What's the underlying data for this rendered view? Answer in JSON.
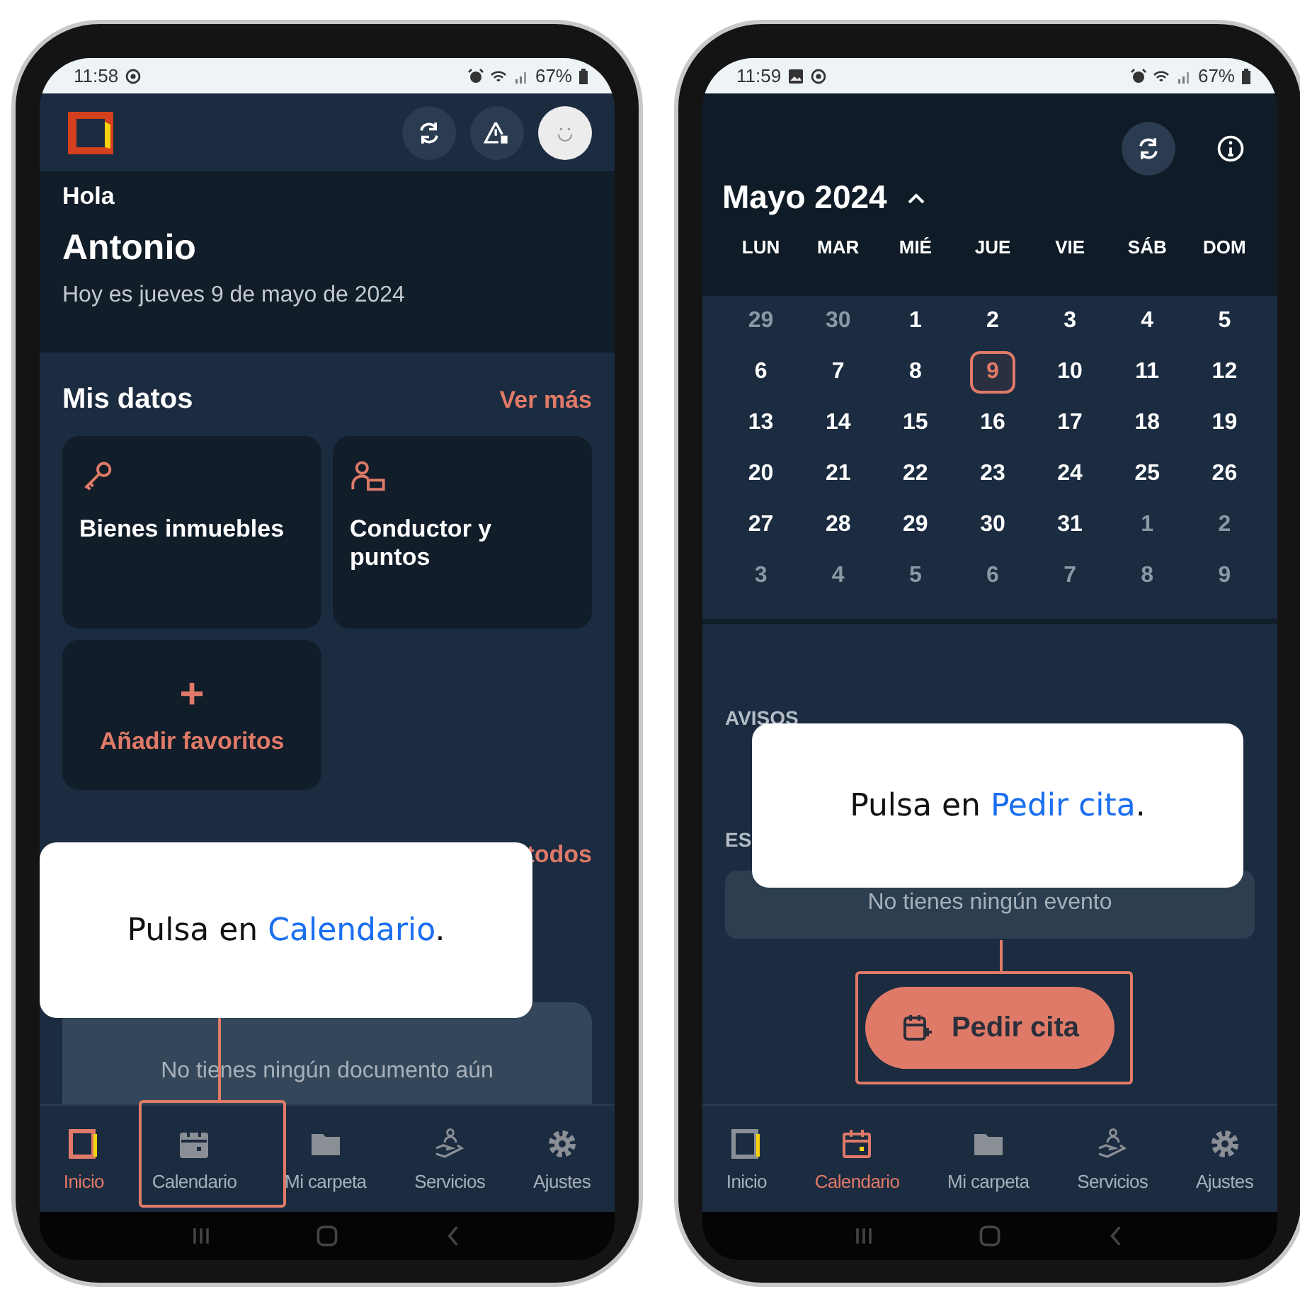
{
  "home_screen": {
    "status_bar": {
      "time": "11:58",
      "battery": "67%"
    },
    "greeting": "Hola",
    "name": "Antonio",
    "date_line": "Hoy es jueves 9 de mayo de 2024",
    "section_title": "Mis datos",
    "section_link": "Ver más",
    "cards": [
      {
        "kind": "key",
        "label": "Bienes inmuebles"
      },
      {
        "kind": "person",
        "label": "Conductor y puntos"
      }
    ],
    "add_favorites": {
      "icon": "+",
      "label": "Añadir favoritos"
    },
    "partial_link": "todos",
    "documents_empty": "No tienes ningún documento aún",
    "nav": [
      {
        "label": "Inicio",
        "selected": true
      },
      {
        "label": "Calendario",
        "selected": false
      },
      {
        "label": "Mi carpeta",
        "selected": false
      },
      {
        "label": "Servicios",
        "selected": false
      },
      {
        "label": "Ajustes",
        "selected": false
      }
    ],
    "callout": "Pulsa en **Calendario**."
  },
  "calendar_screen": {
    "status_bar": {
      "time": "11:59",
      "battery": "67%"
    },
    "month_title": "Mayo 2024",
    "weekdays": [
      "LUN",
      "MAR",
      "MIÉ",
      "JUE",
      "VIE",
      "SÁB",
      "DOM"
    ],
    "weeks": [
      [
        {
          "label": "29",
          "in_month": false,
          "selected": false
        },
        {
          "label": "30",
          "in_month": false,
          "selected": false
        },
        {
          "label": "1",
          "in_month": true,
          "selected": false
        },
        {
          "label": "2",
          "in_month": true,
          "selected": false
        },
        {
          "label": "3",
          "in_month": true,
          "selected": false
        },
        {
          "label": "4",
          "in_month": true,
          "selected": false
        },
        {
          "label": "5",
          "in_month": true,
          "selected": false
        }
      ],
      [
        {
          "label": "6",
          "in_month": true,
          "selected": false
        },
        {
          "label": "7",
          "in_month": true,
          "selected": false
        },
        {
          "label": "8",
          "in_month": true,
          "selected": false
        },
        {
          "label": "9",
          "in_month": true,
          "selected": true
        },
        {
          "label": "10",
          "in_month": true,
          "selected": false
        },
        {
          "label": "11",
          "in_month": true,
          "selected": false
        },
        {
          "label": "12",
          "in_month": true,
          "selected": false
        }
      ],
      [
        {
          "label": "13",
          "in_month": true,
          "selected": false
        },
        {
          "label": "14",
          "in_month": true,
          "selected": false
        },
        {
          "label": "15",
          "in_month": true,
          "selected": false
        },
        {
          "label": "16",
          "in_month": true,
          "selected": false
        },
        {
          "label": "17",
          "in_month": true,
          "selected": false
        },
        {
          "label": "18",
          "in_month": true,
          "selected": false
        },
        {
          "label": "19",
          "in_month": true,
          "selected": false
        }
      ],
      [
        {
          "label": "20",
          "in_month": true,
          "selected": false
        },
        {
          "label": "21",
          "in_month": true,
          "selected": false
        },
        {
          "label": "22",
          "in_month": true,
          "selected": false
        },
        {
          "label": "23",
          "in_month": true,
          "selected": false
        },
        {
          "label": "24",
          "in_month": true,
          "selected": false
        },
        {
          "label": "25",
          "in_month": true,
          "selected": false
        },
        {
          "label": "26",
          "in_month": true,
          "selected": false
        }
      ],
      [
        {
          "label": "27",
          "in_month": true,
          "selected": false
        },
        {
          "label": "28",
          "in_month": true,
          "selected": false
        },
        {
          "label": "29",
          "in_month": true,
          "selected": false
        },
        {
          "label": "30",
          "in_month": true,
          "selected": false
        },
        {
          "label": "31",
          "in_month": true,
          "selected": false
        },
        {
          "label": "1",
          "in_month": false,
          "selected": false
        },
        {
          "label": "2",
          "in_month": false,
          "selected": false
        }
      ],
      [
        {
          "label": "3",
          "in_month": false,
          "selected": false
        },
        {
          "label": "4",
          "in_month": false,
          "selected": false
        },
        {
          "label": "5",
          "in_month": false,
          "selected": false
        },
        {
          "label": "6",
          "in_month": false,
          "selected": false
        },
        {
          "label": "7",
          "in_month": false,
          "selected": false
        },
        {
          "label": "8",
          "in_month": false,
          "selected": false
        },
        {
          "label": "9",
          "in_month": false,
          "selected": false
        }
      ]
    ],
    "notices_heading": "AVISOS",
    "partial_heading": "ES",
    "events_empty": "No tienes ningún evento",
    "action_button": "Pedir cita",
    "nav": [
      {
        "label": "Inicio",
        "selected": false
      },
      {
        "label": "Calendario",
        "selected": true
      },
      {
        "label": "Mi carpeta",
        "selected": false
      },
      {
        "label": "Servicios",
        "selected": false
      },
      {
        "label": "Ajustes",
        "selected": false
      }
    ],
    "callout": "Pulsa en **Pedir cita**."
  }
}
